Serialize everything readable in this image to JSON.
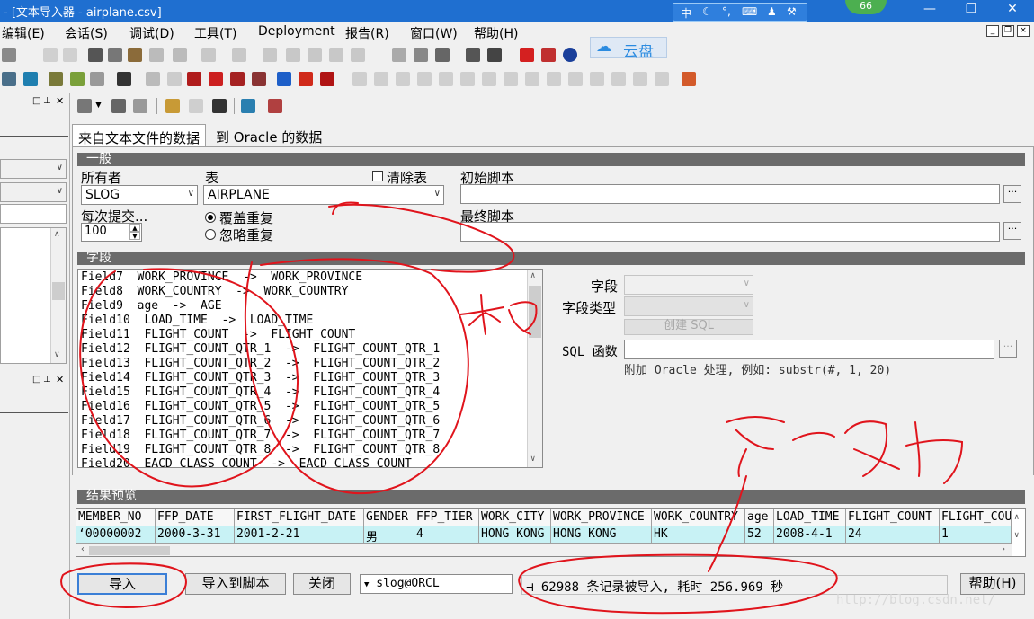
{
  "titlebar": {
    "title": "- [文本导入器 - airplane.csv]",
    "ime_lang": "中",
    "badge": "66"
  },
  "menu": {
    "items": [
      "编辑(E)",
      "会话(S)",
      "调试(D)",
      "工具(T)",
      "Deployment",
      "报告(R)",
      "窗口(W)",
      "帮助(H)"
    ]
  },
  "cloud": {
    "label": "云盘"
  },
  "tabs": {
    "from_text": "来自文本文件的数据",
    "to_oracle": "到 Oracle 的数据"
  },
  "general": {
    "header": "一般",
    "owner_label": "所有者",
    "owner_value": "SLOG",
    "table_label": "表",
    "table_value": "AIRPLANE",
    "clear_table_label": "清除表",
    "commit_label": "每次提交...",
    "commit_value": "100",
    "overwrite_label": "覆盖重复",
    "ignore_label": "忽略重复",
    "init_script_label": "初始脚本",
    "final_script_label": "最终脚本"
  },
  "fields": {
    "header": "字段",
    "rows": [
      "Field7  WORK_PROVINCE  ->  WORK_PROVINCE",
      "Field8  WORK_COUNTRY  ->  WORK_COUNTRY",
      "Field9  age  ->  AGE",
      "Field10  LOAD_TIME  ->  LOAD_TIME",
      "Field11  FLIGHT_COUNT  ->  FLIGHT_COUNT",
      "Field12  FLIGHT_COUNT_QTR_1  ->  FLIGHT_COUNT_QTR_1",
      "Field13  FLIGHT_COUNT_QTR_2  ->  FLIGHT_COUNT_QTR_2",
      "Field14  FLIGHT_COUNT_QTR_3  ->  FLIGHT_COUNT_QTR_3",
      "Field15  FLIGHT_COUNT_QTR_4  ->  FLIGHT_COUNT_QTR_4",
      "Field16  FLIGHT_COUNT_QTR_5  ->  FLIGHT_COUNT_QTR_5",
      "Field17  FLIGHT_COUNT_QTR_6  ->  FLIGHT_COUNT_QTR_6",
      "Field18  FLIGHT_COUNT_QTR_7  ->  FLIGHT_COUNT_QTR_7",
      "Field19  FLIGHT_COUNT_QTR_8  ->  FLIGHT_COUNT_QTR_8",
      "Field20  EACD_CLASS_COUNT  ->  EACD_CLASS_COUNT"
    ],
    "field_label": "字段",
    "field_type_label": "字段类型",
    "create_sql_label": "创建 SQL",
    "sql_func_label": "SQL 函数",
    "hint": "附加 Oracle 处理, 例如:  substr(#, 1, 20)"
  },
  "results": {
    "header": "结果预览",
    "columns": [
      "MEMBER_NO",
      "FFP_DATE",
      "FIRST_FLIGHT_DATE",
      "GENDER",
      "FFP_TIER",
      "WORK_CITY",
      "WORK_PROVINCE",
      "WORK_COUNTRY",
      "age",
      "LOAD_TIME",
      "FLIGHT_COUNT",
      "FLIGHT_COU"
    ],
    "row": [
      "‘00000002",
      "2000-3-31",
      "2001-2-21",
      "男",
      "4",
      "HONG KONG",
      "HONG KONG",
      "HK",
      "52",
      "2008-4-1",
      "24",
      "1"
    ]
  },
  "buttons": {
    "import": "导入",
    "import_to_script": "导入到脚本",
    "close": "关闭",
    "help": "帮助(H)"
  },
  "session": {
    "value": "slog@ORCL"
  },
  "status": {
    "text": "62988 条记录被导入, 耗时 256.969 秒"
  },
  "annotations": {
    "field_note": "字段",
    "success_note": "导入成功"
  },
  "watermark": "http://blog.csdn.net/",
  "colors": {
    "titlebar": "#1f6fd0",
    "section_header": "#6b6b6b",
    "preview_row": "#c8f2f5",
    "annotation_red": "#e0141c"
  }
}
